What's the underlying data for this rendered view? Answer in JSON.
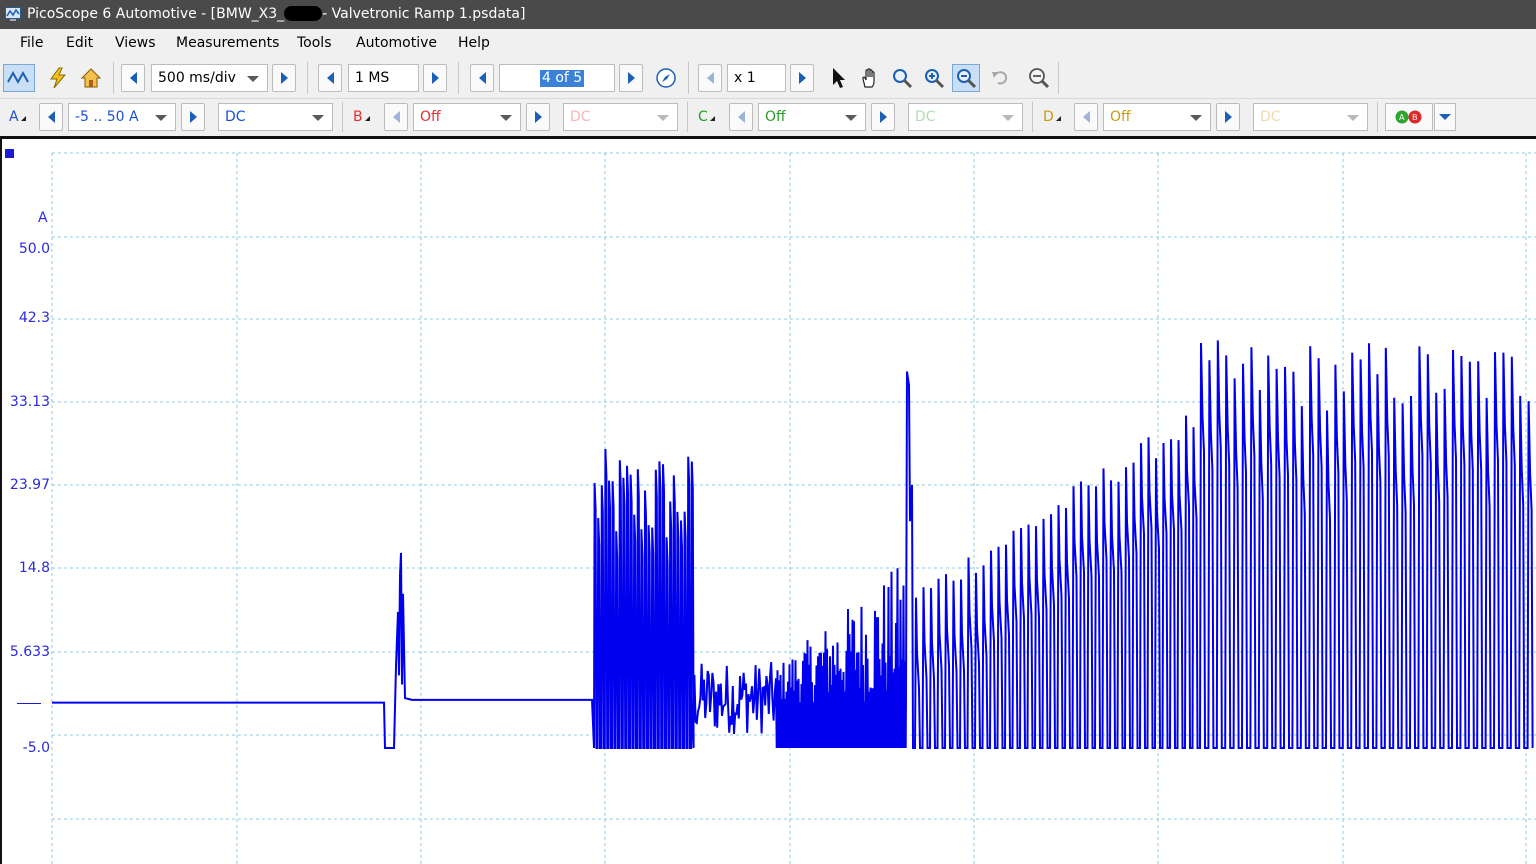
{
  "window": {
    "app_title": "PicoScope 6 Automotive - [BMW_X3_",
    "title_suffix": "- Valvetronic Ramp 1.psdata]"
  },
  "menu": [
    "File",
    "Edit",
    "Views",
    "Measurements",
    "Tools",
    "Automotive",
    "Help"
  ],
  "toolbar": {
    "timebase": "500 ms/div",
    "samples": "1 MS",
    "buffer_page": "4 of 5",
    "zoom": "x 1"
  },
  "channels": [
    {
      "letter": "A",
      "range": "-5 .. 50 A",
      "coupling": "DC",
      "color": "#1a4fd6"
    },
    {
      "letter": "B",
      "range": "Off",
      "coupling": "DC",
      "color": "#e03030"
    },
    {
      "letter": "C",
      "range": "Off",
      "coupling": "DC",
      "color": "#2a9a2a"
    },
    {
      "letter": "D",
      "range": "Off",
      "coupling": "DC",
      "color": "#c89b10"
    }
  ],
  "scope": {
    "unit": "A",
    "y_ticks": [
      "50.0",
      "42.3",
      "33.13",
      "23.97",
      "14.8",
      "5.633",
      "-5.0"
    ],
    "trace_color": "#0000ee"
  },
  "chart_data": {
    "type": "line",
    "ylabel": "A",
    "ylim": [
      -5.0,
      50.0
    ],
    "xlim_divisions": [
      0,
      10
    ],
    "x_unit": "div (500 ms/div)",
    "series": [
      {
        "x": [
          0,
          1.8,
          1.81,
          1.86,
          1.9,
          1.95,
          2.0,
          2.1,
          2.2,
          2.3,
          2.8,
          2.95,
          3.0,
          3.5,
          3.55,
          4.0,
          4.4,
          4.9,
          5.0,
          5.5,
          6.0,
          7.0,
          8.0,
          9.0,
          10.0
        ],
        "y": [
          0.0,
          0.0,
          -4.9,
          -4.9,
          9.0,
          17.0,
          1.0,
          0.5,
          0.3,
          0.3,
          0.3,
          28.0,
          20.0,
          27.5,
          2.0,
          1.0,
          11.0,
          15.5,
          36.5,
          20.0,
          25.0,
          33.0,
          40.0,
          40.0,
          40.0
        ]
      }
    ]
  }
}
